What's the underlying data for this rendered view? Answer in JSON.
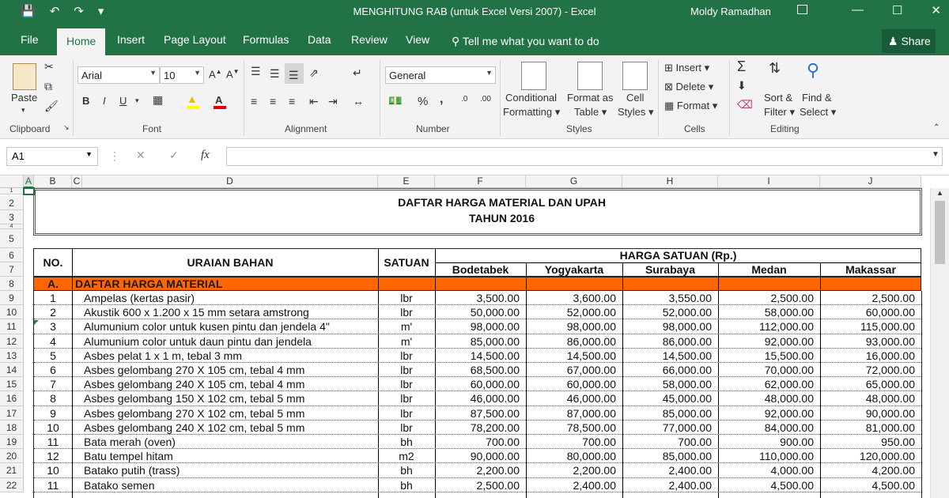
{
  "window": {
    "title": "MENGHITUNG RAB (untuk Excel Versi 2007)  -  Excel",
    "user": "Moldy Ramadhan"
  },
  "tabs": [
    "File",
    "Home",
    "Insert",
    "Page Layout",
    "Formulas",
    "Data",
    "Review",
    "View"
  ],
  "tell_me": "Tell me what you want to do",
  "share": "Share",
  "ribbon": {
    "clipboard": {
      "paste": "Paste",
      "label": "Clipboard"
    },
    "font": {
      "name": "Arial",
      "size": "10",
      "label": "Font",
      "bold": "B",
      "italic": "I",
      "underline": "U"
    },
    "alignment": {
      "label": "Alignment"
    },
    "number": {
      "format": "General",
      "label": "Number",
      "percent": "%",
      "comma": ","
    },
    "styles": {
      "conditional": [
        "Conditional",
        "Formatting"
      ],
      "format_table": [
        "Format as",
        "Table"
      ],
      "cell_styles": [
        "Cell",
        "Styles"
      ],
      "label": "Styles"
    },
    "cells": {
      "insert": "Insert",
      "delete": "Delete",
      "format": "Format",
      "label": "Cells"
    },
    "editing": {
      "sort": [
        "Sort &",
        "Filter"
      ],
      "find": [
        "Find &",
        "Select"
      ],
      "label": "Editing"
    }
  },
  "formula_bar": {
    "name_box": "A1",
    "fx": "fx"
  },
  "columns": [
    "A",
    "B",
    "C",
    "D",
    "E",
    "F",
    "G",
    "H",
    "I",
    "J"
  ],
  "rows": [
    "1",
    "2",
    "3",
    "4",
    "5",
    "6",
    "7",
    "8",
    "9",
    "10",
    "11",
    "12",
    "13",
    "14",
    "15",
    "16",
    "17",
    "18",
    "19",
    "20",
    "21",
    "22"
  ],
  "sheet": {
    "title1": "DAFTAR  HARGA  MATERIAL DAN UPAH",
    "title2": "TAHUN 2016",
    "h_no": "NO.",
    "h_uraian": "URAIAN BAHAN",
    "h_satuan": "SATUAN",
    "h_harga": "HARGA SATUAN (Rp.)",
    "cities": [
      "Bodetabek",
      "Yogyakarta",
      "Surabaya",
      "Medan",
      "Makassar"
    ],
    "section_no": "A.",
    "section_title": "DAFTAR HARGA MATERIAL",
    "section_color": "#ff6600",
    "items": [
      {
        "no": "1",
        "name": "Ampelas (kertas pasir)",
        "unit": "lbr",
        "prices": [
          "3,500.00",
          "3,600.00",
          "3,550.00",
          "2,500.00",
          "2,500.00"
        ]
      },
      {
        "no": "2",
        "name": "Akustik 600 x 1.200 x 15 mm setara amstrong",
        "unit": "lbr",
        "prices": [
          "50,000.00",
          "52,000.00",
          "52,000.00",
          "58,000.00",
          "60,000.00"
        ]
      },
      {
        "no": "3",
        "name": "Alumunium color untuk kusen pintu dan jendela 4\"",
        "unit": "m'",
        "prices": [
          "98,000.00",
          "98,000.00",
          "98,000.00",
          "112,000.00",
          "115,000.00"
        ]
      },
      {
        "no": "4",
        "name": "Alumunium color untuk daun pintu dan jendela",
        "unit": "m'",
        "prices": [
          "85,000.00",
          "86,000.00",
          "86,000.00",
          "92,000.00",
          "93,000.00"
        ]
      },
      {
        "no": "5",
        "name": "Asbes pelat 1 x 1 m, tebal 3 mm",
        "unit": "lbr",
        "prices": [
          "14,500.00",
          "14,500.00",
          "14,500.00",
          "15,500.00",
          "16,000.00"
        ]
      },
      {
        "no": "6",
        "name": "Asbes gelombang 270 X 105 cm, tebal 4 mm",
        "unit": "lbr",
        "prices": [
          "68,500.00",
          "67,000.00",
          "66,000.00",
          "70,000.00",
          "72,000.00"
        ]
      },
      {
        "no": "7",
        "name": "Asbes gelombang 240 X 105 cm, tebal 4 mm",
        "unit": "lbr",
        "prices": [
          "60,000.00",
          "60,000.00",
          "58,000.00",
          "62,000.00",
          "65,000.00"
        ]
      },
      {
        "no": "8",
        "name": "Asbes gelombang 150 X 102 cm, tebal 5 mm",
        "unit": "lbr",
        "prices": [
          "46,000.00",
          "46,000.00",
          "45,000.00",
          "48,000.00",
          "48,000.00"
        ]
      },
      {
        "no": "9",
        "name": "Asbes gelombang 270 X 102 cm, tebal 5 mm",
        "unit": "lbr",
        "prices": [
          "87,500.00",
          "87,000.00",
          "85,000.00",
          "92,000.00",
          "90,000.00"
        ]
      },
      {
        "no": "10",
        "name": "Asbes gelombang 240 X 102 cm, tebal 5 mm",
        "unit": "lbr",
        "prices": [
          "78,200.00",
          "78,500.00",
          "77,000.00",
          "84,000.00",
          "81,000.00"
        ]
      },
      {
        "no": "11",
        "name": "Bata merah (oven)",
        "unit": "bh",
        "prices": [
          "700.00",
          "700.00",
          "700.00",
          "900.00",
          "950.00"
        ]
      },
      {
        "no": "12",
        "name": "Batu tempel hitam",
        "unit": "m2",
        "prices": [
          "90,000.00",
          "80,000.00",
          "85,000.00",
          "110,000.00",
          "120,000.00"
        ]
      },
      {
        "no": "10",
        "name": "Batako putih (trass)",
        "unit": "bh",
        "prices": [
          "2,200.00",
          "2,200.00",
          "2,400.00",
          "4,000.00",
          "4,200.00"
        ]
      },
      {
        "no": "11",
        "name": "Batako semen",
        "unit": "bh",
        "prices": [
          "2,500.00",
          "2,400.00",
          "2,400.00",
          "4,500.00",
          "4,500.00"
        ]
      }
    ]
  }
}
